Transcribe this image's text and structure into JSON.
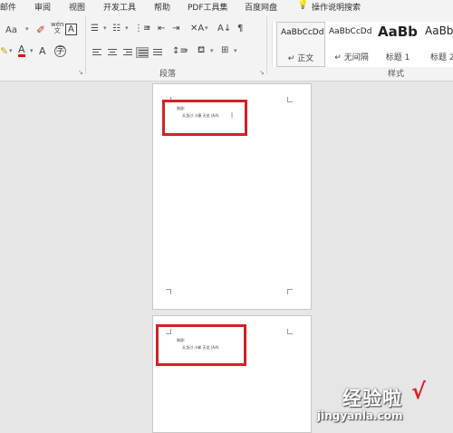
{
  "menu": {
    "items": [
      "邮件",
      "审阅",
      "视图",
      "开发工具",
      "帮助",
      "PDF工具集",
      "百度网盘"
    ],
    "tell_me": "操作说明搜索"
  },
  "ribbon": {
    "font_size_label": "Aa",
    "phonetic_label": "wén\n文",
    "char_border_label": "A",
    "font_color_label": "A",
    "paragraph_group": "段落",
    "styles_group": "样式",
    "styles": [
      {
        "preview": "AaBbCcDd",
        "name": "↵ 正文"
      },
      {
        "preview": "AaBbCcDd",
        "name": "↵ 无间隔"
      },
      {
        "preview": "AaBb",
        "name": "标题 1"
      },
      {
        "preview": "AaBbC",
        "name": "标题 2"
      }
    ]
  },
  "document": {
    "page1": {
      "line1": "致辞:",
      "line2": "天龙讨  小康    天龙 (AA)"
    },
    "page2": {
      "line1": "致辞:",
      "line2": "天龙讨  小邮    天龙 (AA)"
    }
  },
  "watermark": {
    "text": "经验啦",
    "check": "√",
    "url": "jingyanla.com"
  }
}
